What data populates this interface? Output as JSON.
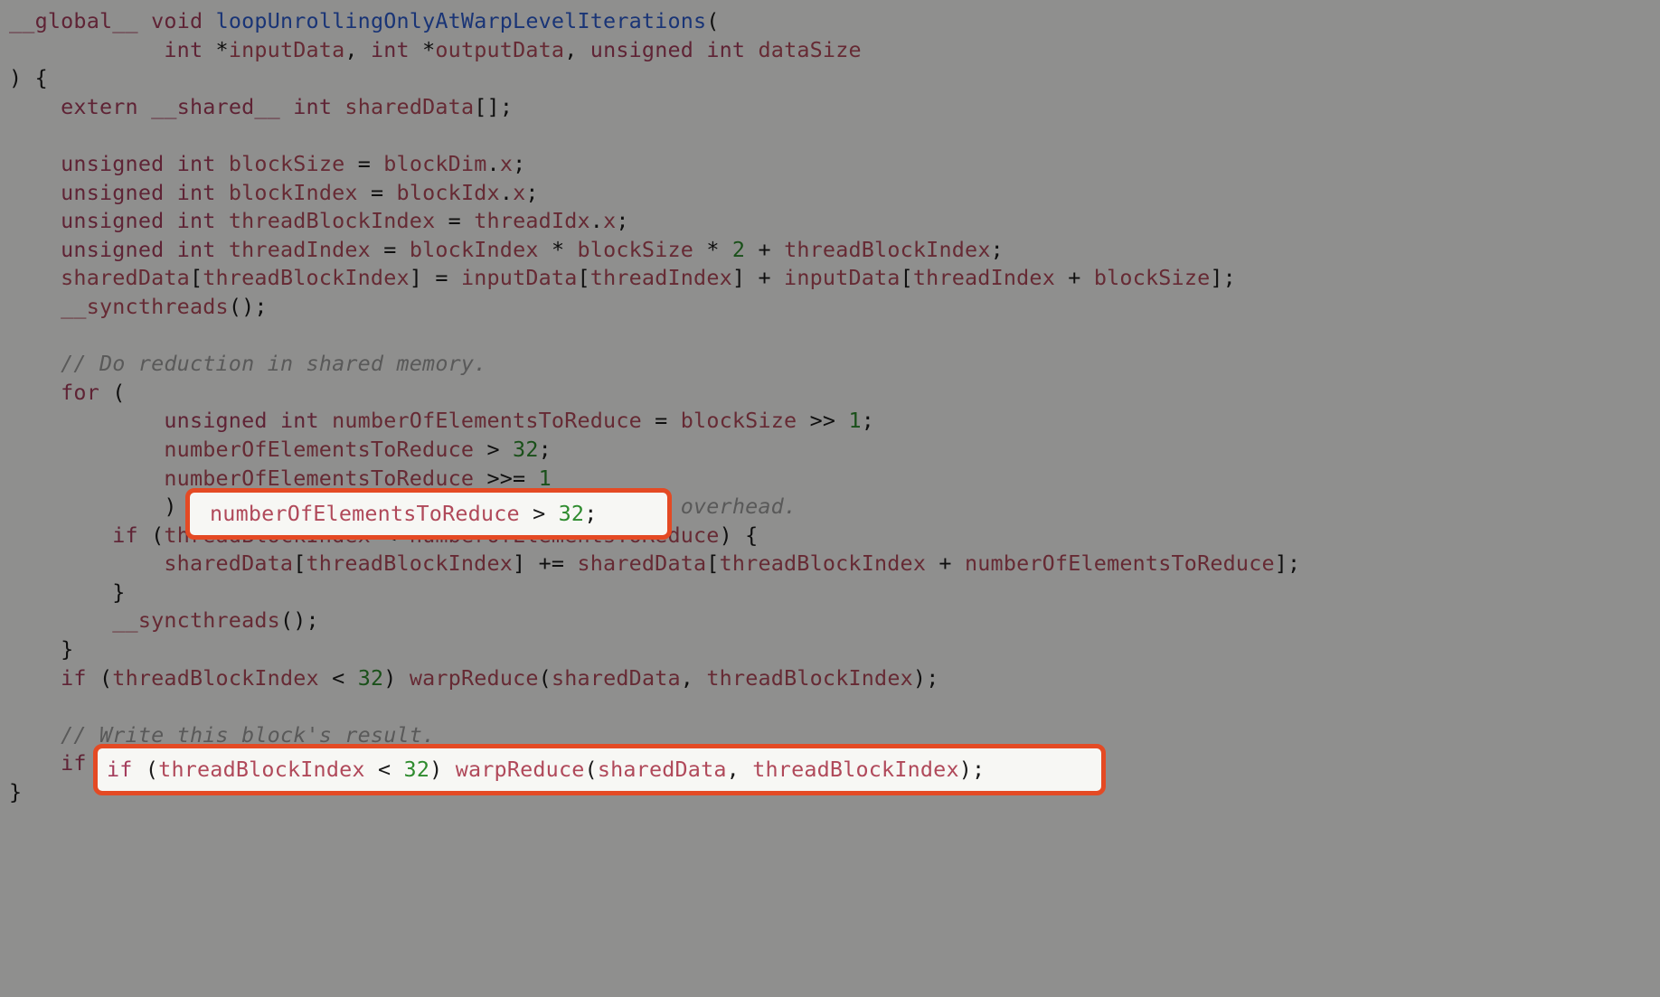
{
  "code": {
    "l1": "__global__ void loopUnrollingOnlyAtWarpLevelIterations(",
    "l2": "            int *inputData, int *outputData, unsigned int dataSize",
    "l3": ") {",
    "l4": "    extern __shared__ int sharedData[];",
    "l5": "",
    "l6": "    unsigned int blockSize = blockDim.x;",
    "l7": "    unsigned int blockIndex = blockIdx.x;",
    "l8": "    unsigned int threadBlockIndex = threadIdx.x;",
    "l9": "    unsigned int threadIndex = blockIndex * blockSize * 2 + threadBlockIndex;",
    "l10": "    sharedData[threadBlockIndex] = inputData[threadIndex] + inputData[threadIndex + blockSize];",
    "l11": "    __syncthreads();",
    "l12": "",
    "l13": "    // Do reduction in shared memory.",
    "l14": "    for (",
    "l15": "            unsigned int numberOfElementsToReduce = blockSize >> 1;",
    "l16": "            numberOfElementsToReduce > 32;",
    "l17": "            numberOfElementsToReduce >>= 1",
    "l18": "            ) {   // This loop produces instruction overhead.",
    "l19": "        if (threadBlockIndex < numberOfElementsToReduce) {",
    "l20": "            sharedData[threadBlockIndex] += sharedData[threadBlockIndex + numberOfElementsToReduce];",
    "l21": "        }",
    "l22": "        __syncthreads();",
    "l23": "    }",
    "l24": "    if (threadBlockIndex < 32) warpReduce(sharedData, threadBlockIndex);",
    "l25": "",
    "l26": "    // Write this block's result.",
    "l27": "    if (threadBlockIndex == 0) outputData[blockIndex] = sharedData[0];",
    "l28": "}"
  },
  "highlights": {
    "h1_line": "numberOfElementsToReduce > 32;",
    "h2_line": "if (threadBlockIndex < 32) warpReduce(sharedData, threadBlockIndex);"
  }
}
